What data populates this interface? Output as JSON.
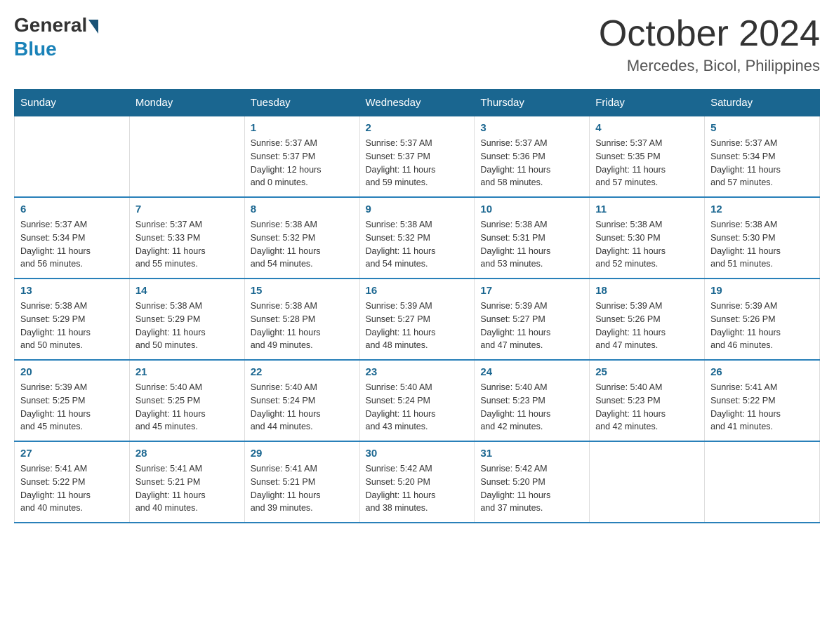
{
  "logo": {
    "general": "General",
    "blue": "Blue"
  },
  "title": "October 2024",
  "location": "Mercedes, Bicol, Philippines",
  "days_of_week": [
    "Sunday",
    "Monday",
    "Tuesday",
    "Wednesday",
    "Thursday",
    "Friday",
    "Saturday"
  ],
  "weeks": [
    [
      {
        "day": "",
        "info": ""
      },
      {
        "day": "",
        "info": ""
      },
      {
        "day": "1",
        "info": "Sunrise: 5:37 AM\nSunset: 5:37 PM\nDaylight: 12 hours\nand 0 minutes."
      },
      {
        "day": "2",
        "info": "Sunrise: 5:37 AM\nSunset: 5:37 PM\nDaylight: 11 hours\nand 59 minutes."
      },
      {
        "day": "3",
        "info": "Sunrise: 5:37 AM\nSunset: 5:36 PM\nDaylight: 11 hours\nand 58 minutes."
      },
      {
        "day": "4",
        "info": "Sunrise: 5:37 AM\nSunset: 5:35 PM\nDaylight: 11 hours\nand 57 minutes."
      },
      {
        "day": "5",
        "info": "Sunrise: 5:37 AM\nSunset: 5:34 PM\nDaylight: 11 hours\nand 57 minutes."
      }
    ],
    [
      {
        "day": "6",
        "info": "Sunrise: 5:37 AM\nSunset: 5:34 PM\nDaylight: 11 hours\nand 56 minutes."
      },
      {
        "day": "7",
        "info": "Sunrise: 5:37 AM\nSunset: 5:33 PM\nDaylight: 11 hours\nand 55 minutes."
      },
      {
        "day": "8",
        "info": "Sunrise: 5:38 AM\nSunset: 5:32 PM\nDaylight: 11 hours\nand 54 minutes."
      },
      {
        "day": "9",
        "info": "Sunrise: 5:38 AM\nSunset: 5:32 PM\nDaylight: 11 hours\nand 54 minutes."
      },
      {
        "day": "10",
        "info": "Sunrise: 5:38 AM\nSunset: 5:31 PM\nDaylight: 11 hours\nand 53 minutes."
      },
      {
        "day": "11",
        "info": "Sunrise: 5:38 AM\nSunset: 5:30 PM\nDaylight: 11 hours\nand 52 minutes."
      },
      {
        "day": "12",
        "info": "Sunrise: 5:38 AM\nSunset: 5:30 PM\nDaylight: 11 hours\nand 51 minutes."
      }
    ],
    [
      {
        "day": "13",
        "info": "Sunrise: 5:38 AM\nSunset: 5:29 PM\nDaylight: 11 hours\nand 50 minutes."
      },
      {
        "day": "14",
        "info": "Sunrise: 5:38 AM\nSunset: 5:29 PM\nDaylight: 11 hours\nand 50 minutes."
      },
      {
        "day": "15",
        "info": "Sunrise: 5:38 AM\nSunset: 5:28 PM\nDaylight: 11 hours\nand 49 minutes."
      },
      {
        "day": "16",
        "info": "Sunrise: 5:39 AM\nSunset: 5:27 PM\nDaylight: 11 hours\nand 48 minutes."
      },
      {
        "day": "17",
        "info": "Sunrise: 5:39 AM\nSunset: 5:27 PM\nDaylight: 11 hours\nand 47 minutes."
      },
      {
        "day": "18",
        "info": "Sunrise: 5:39 AM\nSunset: 5:26 PM\nDaylight: 11 hours\nand 47 minutes."
      },
      {
        "day": "19",
        "info": "Sunrise: 5:39 AM\nSunset: 5:26 PM\nDaylight: 11 hours\nand 46 minutes."
      }
    ],
    [
      {
        "day": "20",
        "info": "Sunrise: 5:39 AM\nSunset: 5:25 PM\nDaylight: 11 hours\nand 45 minutes."
      },
      {
        "day": "21",
        "info": "Sunrise: 5:40 AM\nSunset: 5:25 PM\nDaylight: 11 hours\nand 45 minutes."
      },
      {
        "day": "22",
        "info": "Sunrise: 5:40 AM\nSunset: 5:24 PM\nDaylight: 11 hours\nand 44 minutes."
      },
      {
        "day": "23",
        "info": "Sunrise: 5:40 AM\nSunset: 5:24 PM\nDaylight: 11 hours\nand 43 minutes."
      },
      {
        "day": "24",
        "info": "Sunrise: 5:40 AM\nSunset: 5:23 PM\nDaylight: 11 hours\nand 42 minutes."
      },
      {
        "day": "25",
        "info": "Sunrise: 5:40 AM\nSunset: 5:23 PM\nDaylight: 11 hours\nand 42 minutes."
      },
      {
        "day": "26",
        "info": "Sunrise: 5:41 AM\nSunset: 5:22 PM\nDaylight: 11 hours\nand 41 minutes."
      }
    ],
    [
      {
        "day": "27",
        "info": "Sunrise: 5:41 AM\nSunset: 5:22 PM\nDaylight: 11 hours\nand 40 minutes."
      },
      {
        "day": "28",
        "info": "Sunrise: 5:41 AM\nSunset: 5:21 PM\nDaylight: 11 hours\nand 40 minutes."
      },
      {
        "day": "29",
        "info": "Sunrise: 5:41 AM\nSunset: 5:21 PM\nDaylight: 11 hours\nand 39 minutes."
      },
      {
        "day": "30",
        "info": "Sunrise: 5:42 AM\nSunset: 5:20 PM\nDaylight: 11 hours\nand 38 minutes."
      },
      {
        "day": "31",
        "info": "Sunrise: 5:42 AM\nSunset: 5:20 PM\nDaylight: 11 hours\nand 37 minutes."
      },
      {
        "day": "",
        "info": ""
      },
      {
        "day": "",
        "info": ""
      }
    ]
  ]
}
